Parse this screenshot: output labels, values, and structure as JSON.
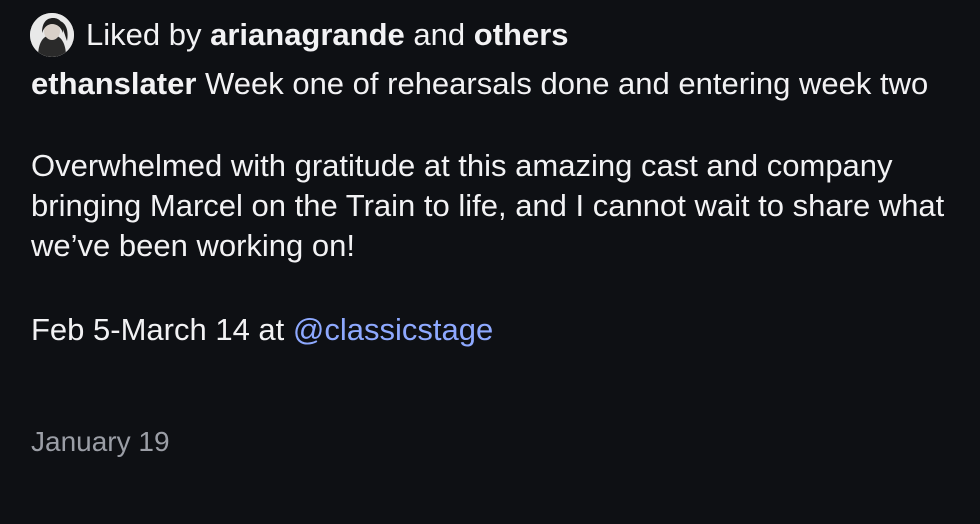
{
  "likes": {
    "liked_by_prefix": "Liked by",
    "first_user": "arianagrande",
    "connector": "and",
    "others": "others"
  },
  "caption": {
    "author": "ethanslater",
    "line1": "Week one of rehearsals done and entering week two",
    "paragraph2": "Overwhelmed with gratitude at this amazing cast and company bringing Marcel on the Train to life, and I cannot wait to share what we’ve been working on!",
    "paragraph3_prefix": "Feb 5-March 14 at",
    "mention": "@classicstage"
  },
  "timestamp": "January 19",
  "colors": {
    "background": "#0e1014",
    "text": "#f2f2f4",
    "mention": "#8ea9ff",
    "muted": "#9b9ea6"
  },
  "icons": {
    "avatar": "profile-avatar"
  }
}
